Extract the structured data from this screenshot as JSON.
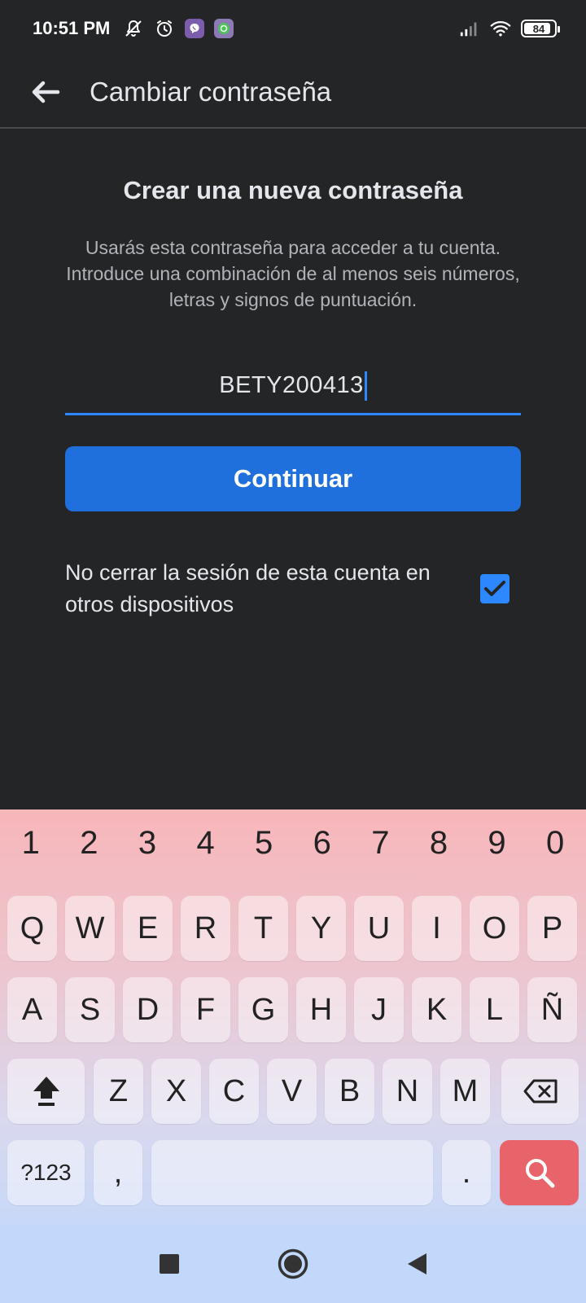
{
  "status_bar": {
    "time": "10:51 PM",
    "battery_level": "84",
    "icons": [
      "mute-bell-icon",
      "alarm-icon",
      "viber-icon",
      "app-notification-icon",
      "signal-icon",
      "wifi-icon",
      "battery-icon"
    ]
  },
  "app_bar": {
    "title": "Cambiar contraseña",
    "back_icon": "arrow-left-icon"
  },
  "form": {
    "heading": "Crear una nueva contraseña",
    "description": "Usarás esta contraseña para acceder a tu cuenta. Introduce una combinación de al menos seis números, letras y signos de puntuación.",
    "password_value": "BETY200413",
    "continue_label": "Continuar",
    "keep_logged_in_label": "No cerrar la sesión de esta cuenta en otros dispositivos",
    "keep_logged_in_checked": true
  },
  "colors": {
    "background": "#242526",
    "accent": "#2d88ff",
    "button": "#1f6fdc",
    "search_key": "#e9636b"
  },
  "keyboard": {
    "numbers": [
      "1",
      "2",
      "3",
      "4",
      "5",
      "6",
      "7",
      "8",
      "9",
      "0"
    ],
    "row1": [
      "Q",
      "W",
      "E",
      "R",
      "T",
      "Y",
      "U",
      "I",
      "O",
      "P"
    ],
    "row2": [
      "A",
      "S",
      "D",
      "F",
      "G",
      "H",
      "J",
      "K",
      "L",
      "Ñ"
    ],
    "row3": [
      "Z",
      "X",
      "C",
      "V",
      "B",
      "N",
      "M"
    ],
    "symbols_label": "?123",
    "comma": ",",
    "period": ".",
    "shift_icon": "shift-icon",
    "backspace_icon": "backspace-icon",
    "search_icon": "search-icon"
  },
  "nav_bar": {
    "icons": [
      "recents-square-icon",
      "home-circle-icon",
      "back-triangle-icon"
    ]
  }
}
